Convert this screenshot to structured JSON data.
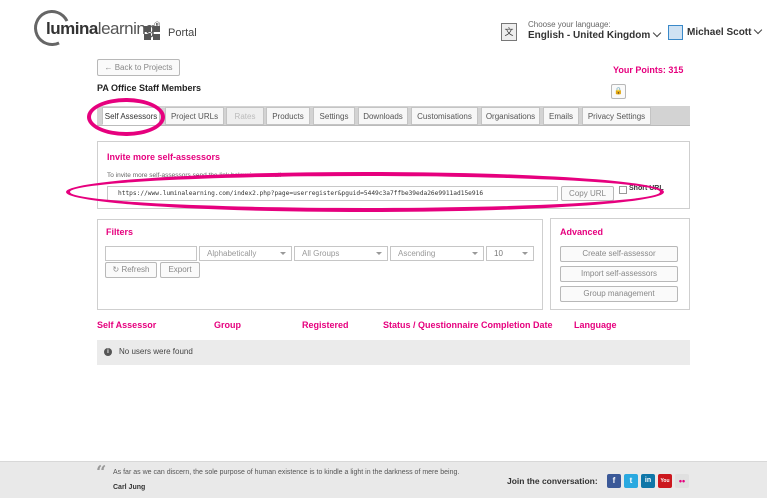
{
  "header": {
    "logo_bold": "lumina",
    "logo_light": "learning",
    "logo_mark": "®",
    "portal_label": "Portal",
    "language_prompt": "Choose your language:",
    "language_value": "English - United Kingdom",
    "user_name": "Michael Scott"
  },
  "project": {
    "back_label": "← Back to Projects",
    "points_label": "Your Points: 315",
    "title": "PA Office Staff Members"
  },
  "tabs": [
    {
      "label": "Self Assessors",
      "state": "active"
    },
    {
      "label": "Project URLs",
      "state": "normal"
    },
    {
      "label": "Rates",
      "state": "disabled"
    },
    {
      "label": "Products",
      "state": "normal"
    },
    {
      "label": "Settings",
      "state": "normal"
    },
    {
      "label": "Downloads",
      "state": "normal"
    },
    {
      "label": "Customisations",
      "state": "normal"
    },
    {
      "label": "Organisations",
      "state": "normal"
    },
    {
      "label": "Emails",
      "state": "normal"
    },
    {
      "label": "Privacy Settings",
      "state": "normal"
    }
  ],
  "invite": {
    "title": "Invite more self-assessors",
    "help_text": "To invite more self-assessors send the link below in an email",
    "url": "https://www.luminalearning.com/index2.php?page=userregister&pguid=5449c3a7ffbe39eda26e9911ad15e916",
    "copy_label": "Copy URL",
    "short_url_label": "Short URL",
    "short_url_checked": false
  },
  "filters": {
    "title": "Filters",
    "search_value": "",
    "sort_value": "Alphabetically",
    "group_value": "All Groups",
    "order_value": "Ascending",
    "per_page_value": "10",
    "refresh_label": "Refresh",
    "export_label": "Export"
  },
  "advanced": {
    "title": "Advanced",
    "create_label": "Create self-assessor",
    "import_label": "Import self-assessors",
    "group_label": "Group management"
  },
  "table": {
    "columns": [
      "Self Assessor",
      "Group",
      "Registered",
      "Status / Questionnaire Completion Date",
      "Language"
    ],
    "empty_message": "No users were found"
  },
  "footer": {
    "quote": "As far as we can discern, the sole purpose of human existence is to kindle a light in the darkness of mere being.",
    "author": "Carl Jung",
    "join_label": "Join the conversation:",
    "social": [
      {
        "icon": "facebook-icon",
        "glyph": "f",
        "color": "#3b5998"
      },
      {
        "icon": "twitter-icon",
        "glyph": "t",
        "color": "#2aa9e0"
      },
      {
        "icon": "linkedin-icon",
        "glyph": "in",
        "color": "#0e76a8"
      },
      {
        "icon": "youtube-icon",
        "glyph": "You",
        "color": "#cc181e"
      },
      {
        "icon": "flickr-icon",
        "glyph": "••",
        "color": "#e0e0e0"
      }
    ]
  },
  "colors": {
    "accent": "#e6007e"
  }
}
